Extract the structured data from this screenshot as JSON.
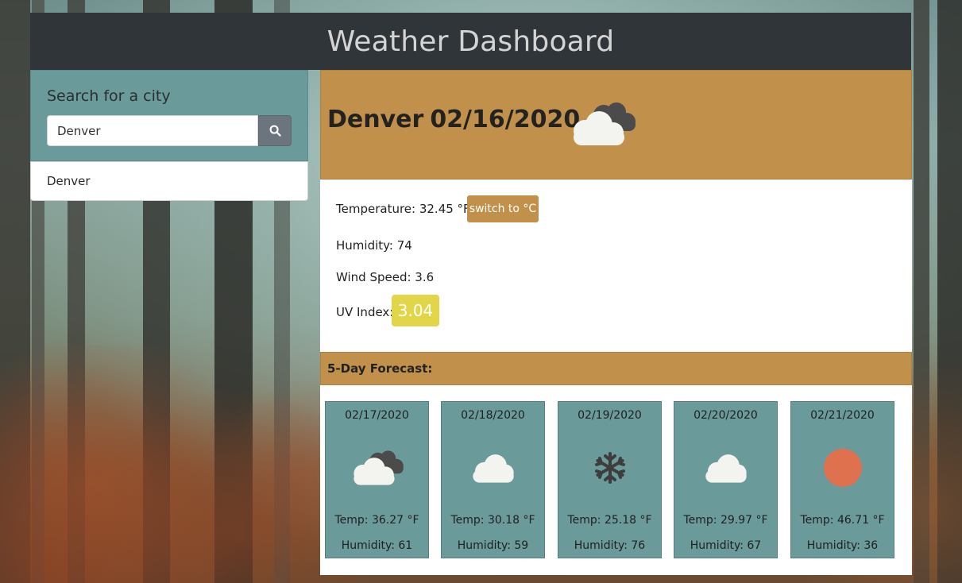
{
  "header": {
    "title": "Weather Dashboard"
  },
  "search": {
    "title": "Search for a city",
    "value": "Denver",
    "button_icon": "search-icon",
    "history": [
      "Denver"
    ]
  },
  "current": {
    "city": "Denver",
    "date": "02/16/2020",
    "icon": "cloudy-icon",
    "temperature": "Temperature: 32.45 °F",
    "unit_button": "switch to °C",
    "humidity": "Humidity: 74",
    "wind": "Wind Speed: 3.6",
    "uv_label": "UV Index:",
    "uv_value": "3.04",
    "uv_color": "#e2d548"
  },
  "forecast": {
    "title": "5-Day Forecast:",
    "days": [
      {
        "date": "02/17/2020",
        "icon": "cloudy-icon",
        "temp": "Temp: 36.27 °F",
        "humidity": "Humidity: 61"
      },
      {
        "date": "02/18/2020",
        "icon": "cloud-icon",
        "temp": "Temp: 30.18 °F",
        "humidity": "Humidity: 59"
      },
      {
        "date": "02/19/2020",
        "icon": "snowflake-icon",
        "temp": "Temp: 25.18 °F",
        "humidity": "Humidity: 76"
      },
      {
        "date": "02/20/2020",
        "icon": "cloud-icon",
        "temp": "Temp: 29.97 °F",
        "humidity": "Humidity: 67"
      },
      {
        "date": "02/21/2020",
        "icon": "sun-icon",
        "temp": "Temp: 46.71 °F",
        "humidity": "Humidity: 36"
      }
    ]
  },
  "colors": {
    "header_bg": "#2f3538",
    "accent": "#c1904b",
    "panel": "#6b9a9b",
    "sun": "#e0714f"
  }
}
